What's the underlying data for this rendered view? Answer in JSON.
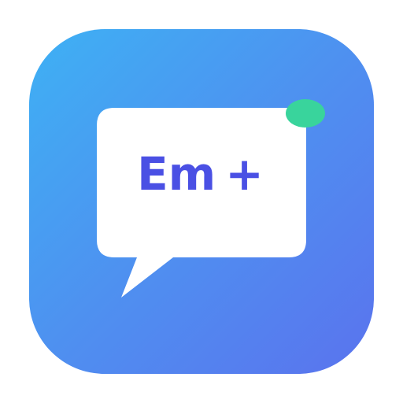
{
  "app_icon": {
    "text": "Em",
    "plus": "+",
    "icons": {
      "bubble": "speech-bubble-icon",
      "dot": "notification-dot-icon"
    },
    "colors": {
      "gradient_start": "#3eb1f4",
      "gradient_end": "#5a73ee",
      "bubble": "#ffffff",
      "text": "#4a50e4",
      "dot": "#39d49c"
    }
  }
}
